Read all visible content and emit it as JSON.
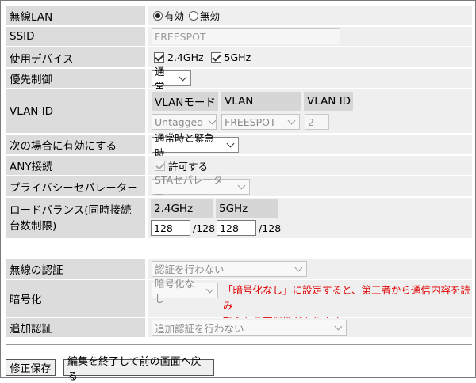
{
  "wireless_lan": {
    "label": "無線LAN",
    "opt_on": "有効",
    "opt_off": "無効"
  },
  "ssid": {
    "label": "SSID",
    "value": "FREESPOT"
  },
  "devices": {
    "label": "使用デバイス",
    "opt1": "2.4GHz",
    "opt2": "5GHz"
  },
  "priority": {
    "label": "優先制御",
    "value": "通常"
  },
  "vlan": {
    "label": "VLAN ID",
    "hdr_mode": "VLANモード",
    "hdr_vlan": "VLAN",
    "hdr_id": "VLAN ID",
    "mode_value": "Untagged",
    "vlan_value": "FREESPOT",
    "id_value": "2"
  },
  "enable_when": {
    "label": "次の場合に有効にする",
    "value": "通常時と緊急時"
  },
  "any": {
    "label": "ANY接続",
    "option": "許可する"
  },
  "privacy": {
    "label": "プライバシーセパレーター",
    "value": "STAセパレーター"
  },
  "load_balance": {
    "label_line1": "ロードバランス(同時接続",
    "label_line2": "台数制限)",
    "hdr_24": "2.4GHz",
    "hdr_5": "5GHz",
    "value_24": "128",
    "max_24": "/128",
    "value_5": "128",
    "max_5": "/128"
  },
  "auth": {
    "label": "無線の認証",
    "value": "認証を行わない"
  },
  "encryption": {
    "label": "暗号化",
    "value": "暗号化なし",
    "warning_line1": "「暗号化なし」に設定すると、第三者から通信内容を読み",
    "warning_line2": "取られる可能性があります。"
  },
  "extra_auth": {
    "label": "追加認証",
    "value": "追加認証を行わない"
  },
  "buttons": {
    "save": "修正保存",
    "back": "編集を終了して前の画面へ戻る"
  }
}
